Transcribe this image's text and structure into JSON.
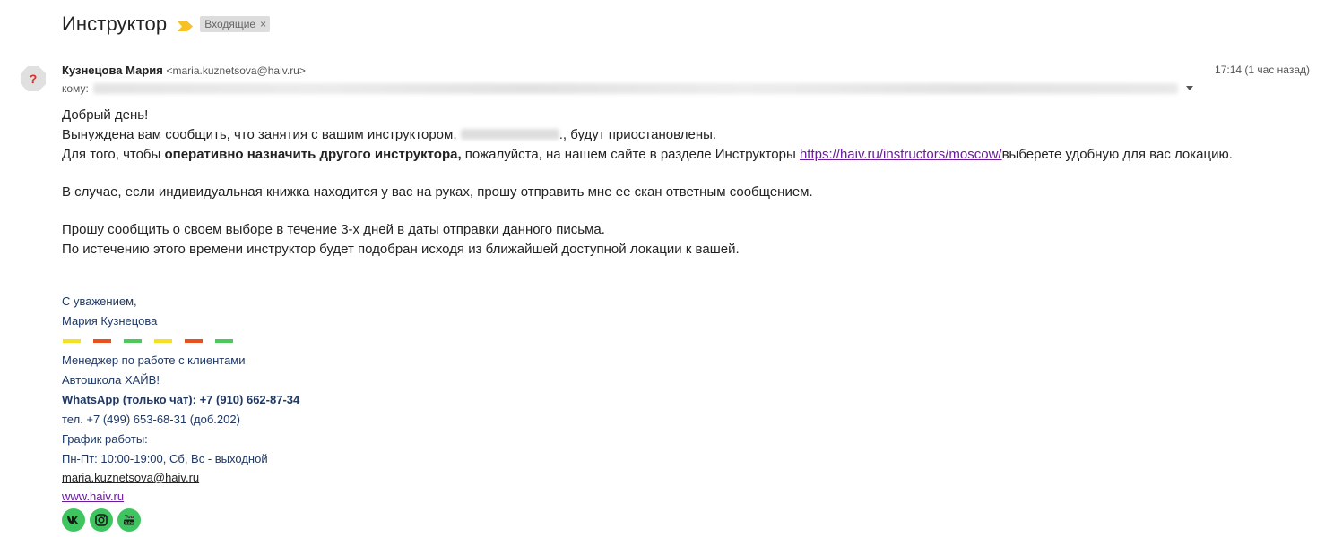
{
  "subject": {
    "title": "Инструктор",
    "label": "Входящие",
    "label_close": "×",
    "importance_color": "#f6c026"
  },
  "sender": {
    "name": "Кузнецова Мария",
    "email": "<maria.kuznetsova@haiv.ru>",
    "avatar_glyph": "?",
    "timestamp": "17:14 (1 час назад)",
    "to_label": "кому:"
  },
  "body": {
    "greeting": "Добрый день!",
    "line1_before": "Вынуждена вам сообщить, что занятия с вашим инструктором, ",
    "line1_after": "., будут приостановлены.",
    "line2_before": "Для того, чтобы ",
    "line2_bold": "оперативно назначить другого инструктора,",
    "line2_middle": " пожалуйста, на нашем сайте в разделе Инструкторы ",
    "line2_link": "https://haiv.ru/instructors/moscow/",
    "line2_after": "выберете удобную для вас локацию.",
    "para2": "В случае, если индивидуальная книжка находится у вас на руках, прошу отправить мне ее скан ответным сообщением.",
    "para3_line1": "Прошу сообщить о своем выборе в течение 3-х дней в даты отправки данного письма.",
    "para3_line2": "По истечению этого времени инструктор будет подобран исходя из ближайшей доступной локации к вашей."
  },
  "signature": {
    "regards": "С уважением,",
    "name": "Мария Кузнецова",
    "stripe_colors": [
      "#f5e023",
      "#e8501e",
      "#4cc95a",
      "#f5e023",
      "#e8501e",
      "#4cc95a"
    ],
    "position": "Менеджер по работе с клиентами",
    "company": "Автошкола ХАЙВ!",
    "whatsapp": "WhatsApp (только чат): +7 (910) 662-87-34",
    "phone": "тел. +7 (499) 653-68-31 (доб.202)",
    "schedule_label": "График работы:",
    "schedule": "Пн-Пт: 10:00-19:00, Сб, Вс - выходной",
    "email": "maria.kuznetsova@haiv.ru",
    "site": "www.haiv.ru",
    "social": {
      "vk": "vk",
      "youtube": "You Tube",
      "color": "#3fc55f"
    }
  }
}
